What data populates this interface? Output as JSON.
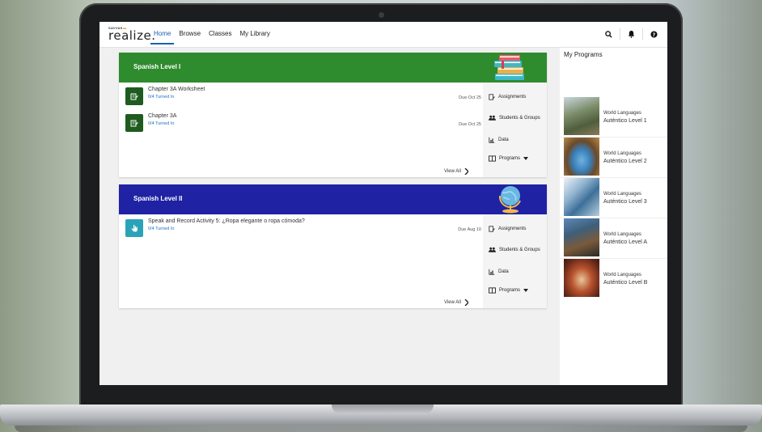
{
  "app": {
    "logo_small": "SAVVAS",
    "logo_main": "realize.",
    "nav": [
      "Home",
      "Browse",
      "Classes",
      "My Library"
    ],
    "active_nav": "Home"
  },
  "top_icons": [
    "search-icon",
    "bell-icon",
    "help-icon"
  ],
  "classes": [
    {
      "name": "Spanish Level I",
      "color": "#2e8b2e",
      "assignments": [
        {
          "title": "Chapter 3A Worksheet",
          "turned_in": "0/4 Turned In",
          "due": "Due Oct 25",
          "icon_color": "#1e5b1e"
        },
        {
          "title": "Chapter 3A",
          "turned_in": "0/4 Turned In",
          "due": "Due Oct 25",
          "icon_color": "#1e5b1e"
        }
      ],
      "side": {
        "assignments": "Assignments",
        "students": "Students & Groups",
        "data": "Data",
        "programs": "Programs"
      },
      "view_all": "View All"
    },
    {
      "name": "Spanish Level II",
      "color": "#1f22a3",
      "assignments": [
        {
          "title": "Speak and Record Activity 5: ¿Ropa elegante o ropa cómoda?",
          "turned_in": "0/4 Turned In",
          "due": "Due Aug 10",
          "icon_color": "#2aa3b8"
        }
      ],
      "side": {
        "assignments": "Assignments",
        "students": "Students & Groups",
        "data": "Data",
        "programs": "Programs"
      },
      "view_all": "View All"
    }
  ],
  "my_programs": {
    "title": "My Programs",
    "items": [
      {
        "line1": "World Languages",
        "line2": "Auténtico Level 1"
      },
      {
        "line1": "World Languages",
        "line2": "Auténtico Level 2"
      },
      {
        "line1": "World Languages",
        "line2": "Auténtico Level 3"
      },
      {
        "line1": "World Languages",
        "line2": "Auténtico Level A"
      },
      {
        "line1": "World Languages",
        "line2": "Auténtico Level B"
      }
    ]
  }
}
